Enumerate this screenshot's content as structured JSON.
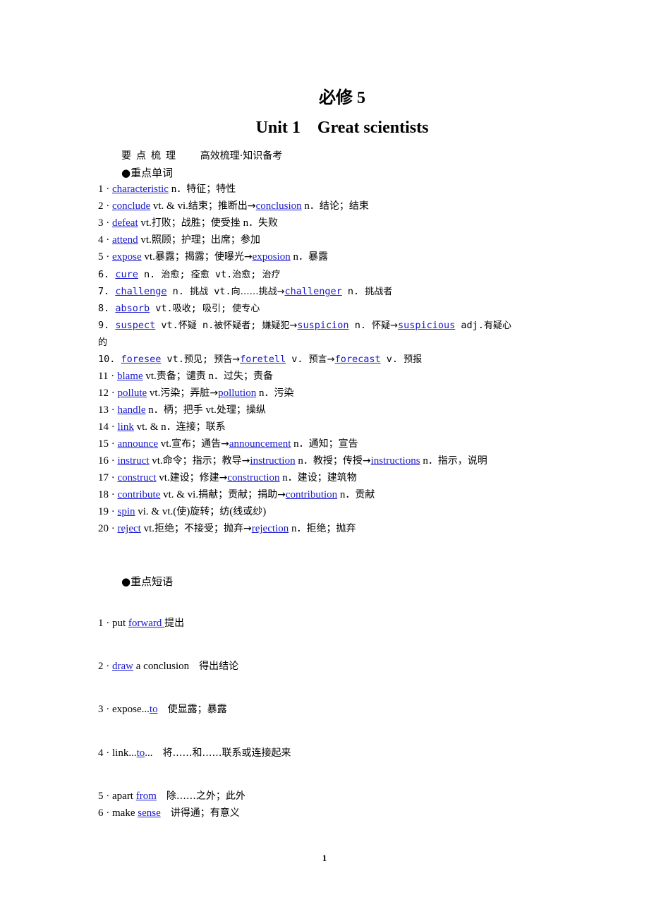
{
  "header": {
    "book": "必修 5",
    "unit": "Unit 1    Great scientists"
  },
  "section": {
    "title": "要点梳理",
    "subtitle": "高效梳理·知识备考"
  },
  "vocab": {
    "heading": "●重点单词",
    "items": [
      {
        "num": "1 · ",
        "parts": [
          [
            "w",
            "characteristic"
          ],
          [
            "t",
            " n．特征；特性"
          ]
        ]
      },
      {
        "num": "2 · ",
        "parts": [
          [
            "w",
            "conclude"
          ],
          [
            "t",
            " vt. & vi.结束；推断出→"
          ],
          [
            "w",
            "conclusion"
          ],
          [
            "t",
            " n．结论；结束"
          ]
        ]
      },
      {
        "num": "3 · ",
        "parts": [
          [
            "w",
            "defeat"
          ],
          [
            "t",
            " vt.打败；战胜；使受挫  n．失败"
          ]
        ]
      },
      {
        "num": "4 · ",
        "parts": [
          [
            "w",
            "attend"
          ],
          [
            "t",
            " vt.照顾；护理；出席；参加"
          ]
        ]
      },
      {
        "num": "5 · ",
        "parts": [
          [
            "w",
            "expose"
          ],
          [
            "t",
            " vt.暴露；揭露；使曝光→"
          ],
          [
            "w",
            "exposion"
          ],
          [
            "t",
            " n．暴露"
          ]
        ]
      },
      {
        "num": "6. ",
        "mono": true,
        "parts": [
          [
            "w",
            "cure"
          ],
          [
            "t",
            " n. 治愈; 痊愈 vt.治愈; 治疗"
          ]
        ]
      },
      {
        "num": "7. ",
        "mono": true,
        "parts": [
          [
            "w",
            "challenge"
          ],
          [
            "t",
            " n. 挑战 vt.向……挑战→"
          ],
          [
            "w",
            "challenger"
          ],
          [
            "t",
            " n. 挑战者"
          ]
        ]
      },
      {
        "num": "8. ",
        "mono": true,
        "parts": [
          [
            "w",
            "absorb"
          ],
          [
            "t",
            " vt.吸收; 吸引; 使专心"
          ]
        ]
      },
      {
        "num": "9. ",
        "mono": true,
        "parts": [
          [
            "w",
            "suspect"
          ],
          [
            "t",
            " vt.怀疑 n.被怀疑者; 嫌疑犯→"
          ],
          [
            "w",
            "suspicion"
          ],
          [
            "t",
            " n. 怀疑→"
          ],
          [
            "w",
            "suspicious"
          ],
          [
            "t",
            " adj.有疑心"
          ]
        ],
        "wrap": "的"
      },
      {
        "num": "10. ",
        "mono": true,
        "parts": [
          [
            "w",
            "foresee"
          ],
          [
            "t",
            " vt.预见; 预告→"
          ],
          [
            "w",
            "foretell"
          ],
          [
            "t",
            " v. 预言→"
          ],
          [
            "w",
            "forecast"
          ],
          [
            "t",
            " v. 预报"
          ]
        ]
      },
      {
        "num": "11 · ",
        "parts": [
          [
            "w",
            "blame"
          ],
          [
            "t",
            " vt.责备；谴责  n．过失；责备"
          ]
        ]
      },
      {
        "num": "12 · ",
        "parts": [
          [
            "w",
            "pollute"
          ],
          [
            "t",
            " vt.污染；弄脏→"
          ],
          [
            "w",
            "pollution"
          ],
          [
            "t",
            " n．污染"
          ]
        ]
      },
      {
        "num": "13 · ",
        "parts": [
          [
            "w",
            "handle"
          ],
          [
            "t",
            " n．柄；把手  vt.处理；操纵"
          ]
        ]
      },
      {
        "num": "14 · ",
        "parts": [
          [
            "w",
            "link"
          ],
          [
            "t",
            " vt. & n．连接；联系"
          ]
        ]
      },
      {
        "num": "15 · ",
        "parts": [
          [
            "w",
            "announce"
          ],
          [
            "t",
            " vt.宣布；通告→"
          ],
          [
            "w",
            "announcement"
          ],
          [
            "t",
            " n．通知；宣告"
          ]
        ]
      },
      {
        "num": "16 · ",
        "parts": [
          [
            "w",
            "instruct"
          ],
          [
            "t",
            " vt.命令；指示；教导→"
          ],
          [
            "w",
            "instruction"
          ],
          [
            "t",
            " n．教授；传授→"
          ],
          [
            "w",
            "instructions"
          ],
          [
            "t",
            " n．指示，说明"
          ]
        ]
      },
      {
        "num": "17 · ",
        "parts": [
          [
            "w",
            "construct"
          ],
          [
            "t",
            " vt.建设；修建→"
          ],
          [
            "w",
            "construction"
          ],
          [
            "t",
            " n．建设；建筑物"
          ]
        ]
      },
      {
        "num": "18 · ",
        "parts": [
          [
            "w",
            "contribute"
          ],
          [
            "t",
            " vt. & vi.捐献；贡献；捐助→"
          ],
          [
            "w",
            "contribution"
          ],
          [
            "t",
            " n．贡献"
          ]
        ]
      },
      {
        "num": "19 · ",
        "parts": [
          [
            "w",
            "spin"
          ],
          [
            "t",
            " vi. & vt.(使)旋转；纺(线或纱)"
          ]
        ]
      },
      {
        "num": "20 · ",
        "parts": [
          [
            "w",
            "reject"
          ],
          [
            "t",
            " vt.拒绝；不接受；抛弃→"
          ],
          [
            "w",
            "rejection"
          ],
          [
            "t",
            " n．拒绝；抛弃"
          ]
        ]
      }
    ]
  },
  "phrases": {
    "heading": "●重点短语",
    "items": [
      {
        "num": "1 · ",
        "parts": [
          [
            "t",
            "put "
          ],
          [
            "w",
            "forward "
          ],
          [
            "t",
            "提出"
          ]
        ]
      },
      {
        "num": "2 · ",
        "parts": [
          [
            "w",
            "draw"
          ],
          [
            "t",
            " a conclusion　得出结论"
          ]
        ]
      },
      {
        "num": "3 · ",
        "parts": [
          [
            "t",
            "expose..."
          ],
          [
            "w",
            "to"
          ],
          [
            "t",
            "　使显露；暴露"
          ]
        ]
      },
      {
        "num": "4 · ",
        "parts": [
          [
            "t",
            "link..."
          ],
          [
            "w",
            "to"
          ],
          [
            "t",
            "...　将……和……联系或连接起来"
          ]
        ]
      },
      {
        "num": "5 · ",
        "parts": [
          [
            "t",
            "apart "
          ],
          [
            "w",
            "from"
          ],
          [
            "t",
            "　除……之外；此外"
          ]
        ]
      },
      {
        "num": "6 · ",
        "parts": [
          [
            "t",
            "make "
          ],
          [
            "w",
            "sense"
          ],
          [
            "t",
            "　讲得通；有意义"
          ]
        ]
      }
    ]
  },
  "footer": {
    "page_number": "1"
  }
}
